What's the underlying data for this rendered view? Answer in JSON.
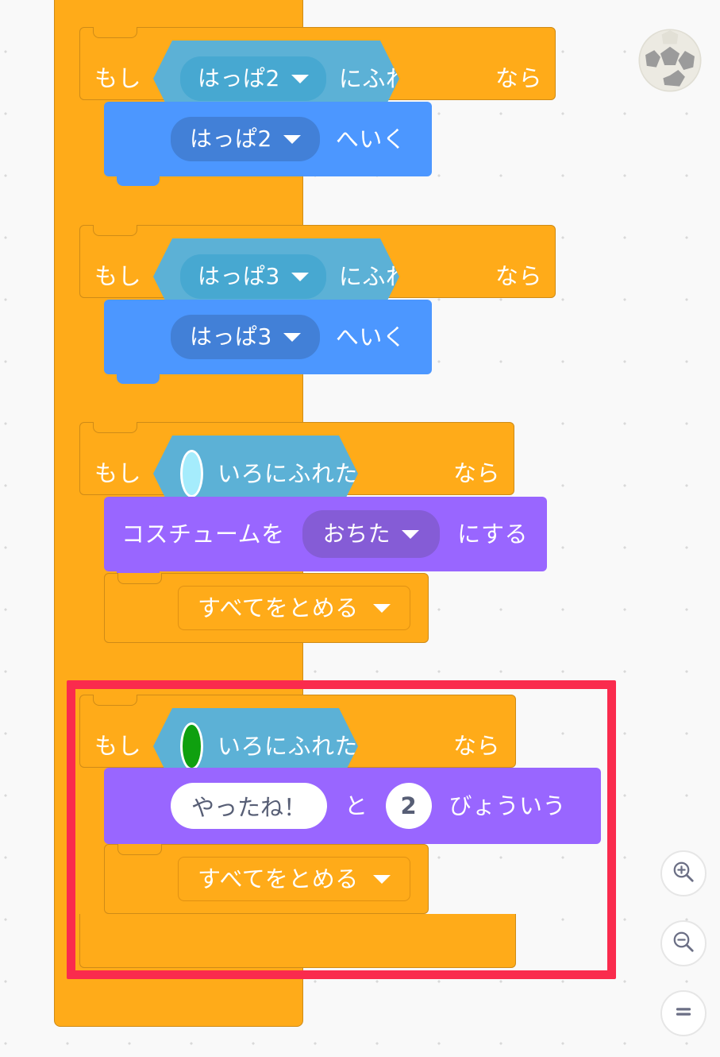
{
  "app": {
    "name": "scratch-block-editor",
    "language": "ja",
    "canvas_background": "#f9f9f9"
  },
  "colors": {
    "control": "#ffab19",
    "control_shadow": "#cf8b17",
    "sensing": "#5cb1d6",
    "sensing_field": "#47a8d1",
    "motion": "#4c97ff",
    "motion_field": "#4280d7",
    "looks": "#9966ff",
    "looks_field": "#855cd6",
    "highlight_border": "#fa2b4d",
    "swatch_cyan": "#a5ecfc",
    "swatch_green": "#0fa00f"
  },
  "script": {
    "wrapper_block": "forever",
    "wrapper_icon": "loop-arrow-icon",
    "branches": [
      {
        "id": "if-happa2",
        "if_label": "もし",
        "then_label": "なら",
        "condition": {
          "kind": "touching-object",
          "target": "はっぱ2",
          "dropdown_icon": "chevron-down-icon",
          "suffix": "にふれた"
        },
        "body": [
          {
            "kind": "glide-to",
            "target": "はっぱ2",
            "dropdown_icon": "chevron-down-icon",
            "suffix": "へいく"
          }
        ]
      },
      {
        "id": "if-happa3",
        "if_label": "もし",
        "then_label": "なら",
        "condition": {
          "kind": "touching-object",
          "target": "はっぱ3",
          "dropdown_icon": "chevron-down-icon",
          "suffix": "にふれた"
        },
        "body": [
          {
            "kind": "glide-to",
            "target": "はっぱ3",
            "dropdown_icon": "chevron-down-icon",
            "suffix": "へいく"
          }
        ]
      },
      {
        "id": "if-touching-cyan",
        "if_label": "もし",
        "then_label": "なら",
        "condition": {
          "kind": "touching-color",
          "color": "#a5ecfc",
          "suffix": "いろにふれた"
        },
        "body": [
          {
            "kind": "switch-costume",
            "prefix": "コスチュームを",
            "value": "おちた",
            "dropdown_icon": "chevron-down-icon",
            "suffix": "にする"
          },
          {
            "kind": "stop",
            "value": "すべてをとめる",
            "dropdown_icon": "chevron-down-icon"
          }
        ]
      },
      {
        "id": "if-touching-green",
        "highlighted": true,
        "if_label": "もし",
        "then_label": "なら",
        "condition": {
          "kind": "touching-color",
          "color": "#0fa00f",
          "suffix": "いろにふれた"
        },
        "body": [
          {
            "kind": "say-for-seconds",
            "message": "やったね！",
            "joiner": "と",
            "seconds": "2",
            "suffix": "びょういう"
          },
          {
            "kind": "stop",
            "value": "すべてをとめる",
            "dropdown_icon": "chevron-down-icon"
          }
        ]
      }
    ]
  },
  "sprite": {
    "name": "soccer-ball",
    "label": "サッカーボール"
  },
  "zoom_controls": [
    {
      "name": "zoom-in-button",
      "icon": "magnifier-plus-icon",
      "glyph": "+"
    },
    {
      "name": "zoom-out-button",
      "icon": "magnifier-minus-icon",
      "glyph": "−"
    },
    {
      "name": "zoom-reset-button",
      "icon": "equals-icon",
      "glyph": "="
    }
  ]
}
